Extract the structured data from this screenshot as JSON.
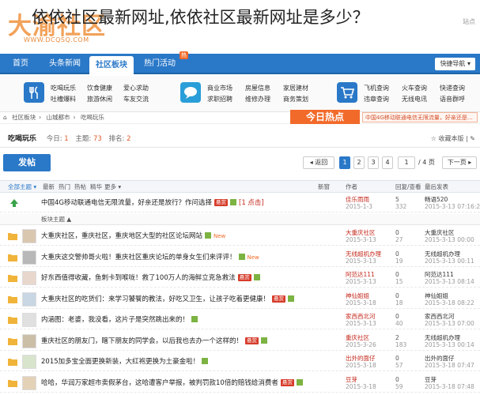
{
  "overlay_title": "依依社区最新网址,依依社区最新网址是多少？",
  "logo": {
    "big_text": "大渝社区",
    "url": "WWW.DCQSQ.COM"
  },
  "header_right": "站点",
  "nav": {
    "items": [
      {
        "label": "首页"
      },
      {
        "label": "头条新闻"
      },
      {
        "label": "社区板块"
      },
      {
        "label": "热门活动"
      }
    ],
    "badge": "热",
    "quick_nav": "快捷导航 ▾"
  },
  "categories": [
    {
      "icon": "fork-knife-icon",
      "color": "#2a78c8",
      "links": [
        "吃喝玩乐",
        "吐槽爆料"
      ],
      "links2": [
        "饮食健康",
        "旅游休闲"
      ],
      "links3": [
        "爱心求助",
        "车友交流"
      ]
    },
    {
      "icon": "chat-bubble-icon",
      "color": "#2a9ed8",
      "links": [
        "商业市场",
        "求职招聘"
      ],
      "links2": [
        "房屋信息",
        "维修办理"
      ],
      "links3": [
        "家居建材",
        "商务策划"
      ]
    },
    {
      "icon": "cart-icon",
      "color": "#2a78c8",
      "links": [
        "飞机查询",
        "违章查询"
      ],
      "links2": [
        "火车查询",
        "无线电讯"
      ],
      "links3": [
        "快递查询",
        "语音群呼"
      ]
    }
  ],
  "breadcrumb": [
    "社区板块",
    "山城都市",
    "吃喝玩乐"
  ],
  "today_hot": {
    "label": "今日热点",
    "marquee": "中国4G移动联通电信无限流量，好亲还是..."
  },
  "forum": {
    "name": "吃喝玩乐",
    "today_label": "今日:",
    "today": "1",
    "topics_label": "主题:",
    "topics": "73",
    "rank_label": "排名:",
    "rank": "2",
    "actions": "☆ 收藏本版  |  ✎"
  },
  "post_button": "发帖",
  "pager": {
    "prev": "◂ 返回",
    "pages": [
      "1",
      "2",
      "3",
      "4"
    ],
    "current": "1",
    "total": "/ 4 页",
    "next": "下一页 ▸"
  },
  "table_header": {
    "filters": [
      "全部主题 ▾",
      "最新",
      "热门",
      "热帖",
      "精华",
      "更多 ▾"
    ],
    "new": "新窗",
    "author": "作者",
    "replies": "回复/查看",
    "last": "最后发表"
  },
  "pinned_row": {
    "title": "中国4G移动联通电信无限流量，好亲还是放行？作问选择",
    "tag": "悬赏",
    "extra": "[1 点击]",
    "author": "佳乐雨雨",
    "date": "2015-1-3",
    "replies": "5",
    "views": "332",
    "last_user": "畅语520",
    "last_date": "2015-3-13 07:16:22"
  },
  "section_label": "板块主题 ▲",
  "threads": [
    {
      "title": "大重庆社区，重庆社区，重庆地区大型的社区论坛网站",
      "flag": "New",
      "img": true,
      "author": "大重庆社区",
      "date": "2015-3-13",
      "replies": "0",
      "views": "27",
      "last_user": "大重庆社区",
      "last_date": "2015-3-13 00:00"
    },
    {
      "title": "大重庆这交警帅哥火啦！重庆社区重庆论坛的单身女生们来评评！",
      "flag": "New",
      "img": true,
      "author": "无线超机办理",
      "date": "2015-3-13",
      "replies": "0",
      "views": "19",
      "last_user": "无线超机办理",
      "last_date": "2015-3-13 00:11"
    },
    {
      "title": "好东西值得收藏，鱼刺卡到喉咙！救了100万人的海鲜立克急救法",
      "tag": "悬赏",
      "img": true,
      "author": "阿范达111",
      "date": "2015-3-13",
      "replies": "0",
      "views": "15",
      "last_user": "阿范达111",
      "last_date": "2015-3-13 08:14"
    },
    {
      "title": "大重庆社区的吃货们：来学习饕餮的教法，好吃又卫生，让孩子吃着更健康！",
      "tag": "悬赏",
      "img": true,
      "author": "神仙姐姐",
      "date": "2015-3-18",
      "replies": "0",
      "views": "18",
      "last_user": "神仙姐姐",
      "last_date": "2015-3-18 08:22"
    },
    {
      "title": "内涵图：老婆，我没看，这片子是突然跳出来的！",
      "img": true,
      "author": "家西西北河",
      "date": "2015-3-13",
      "replies": "0",
      "views": "40",
      "last_user": "家西西北河",
      "last_date": "2015-3-13 07:00"
    },
    {
      "title": "重庆社区的朋友门，瞎下朋友的同学会，以后我也去办一个这样的！",
      "tag": "悬赏",
      "img": true,
      "author": "重庆社区",
      "date": "2015-3-26",
      "replies": "2",
      "views": "183",
      "last_user": "无线超机办理",
      "last_date": "2015-3-13 00:14"
    },
    {
      "title": "2015加多宝全面更换新装，大红袍更换为土豪金啦！",
      "img": true,
      "author": "出外的面仔",
      "date": "2015-3-18",
      "replies": "0",
      "views": "57",
      "last_user": "出外的面仔",
      "last_date": "2015-3-18 07:47"
    },
    {
      "title": "哈哈，华润万家超市卖假茅台，这哈遭客户举报，被判罚款10倍的赔钱给消费者",
      "tag": "悬赏",
      "img": true,
      "author": "豆芽",
      "date": "2015-3-18",
      "replies": "0",
      "views": "59",
      "last_user": "豆芽",
      "last_date": "2015-3-18 07:48"
    }
  ],
  "colors": {
    "nav": "#2a78c8",
    "accent": "#f26a2a",
    "red": "#c4291c"
  }
}
